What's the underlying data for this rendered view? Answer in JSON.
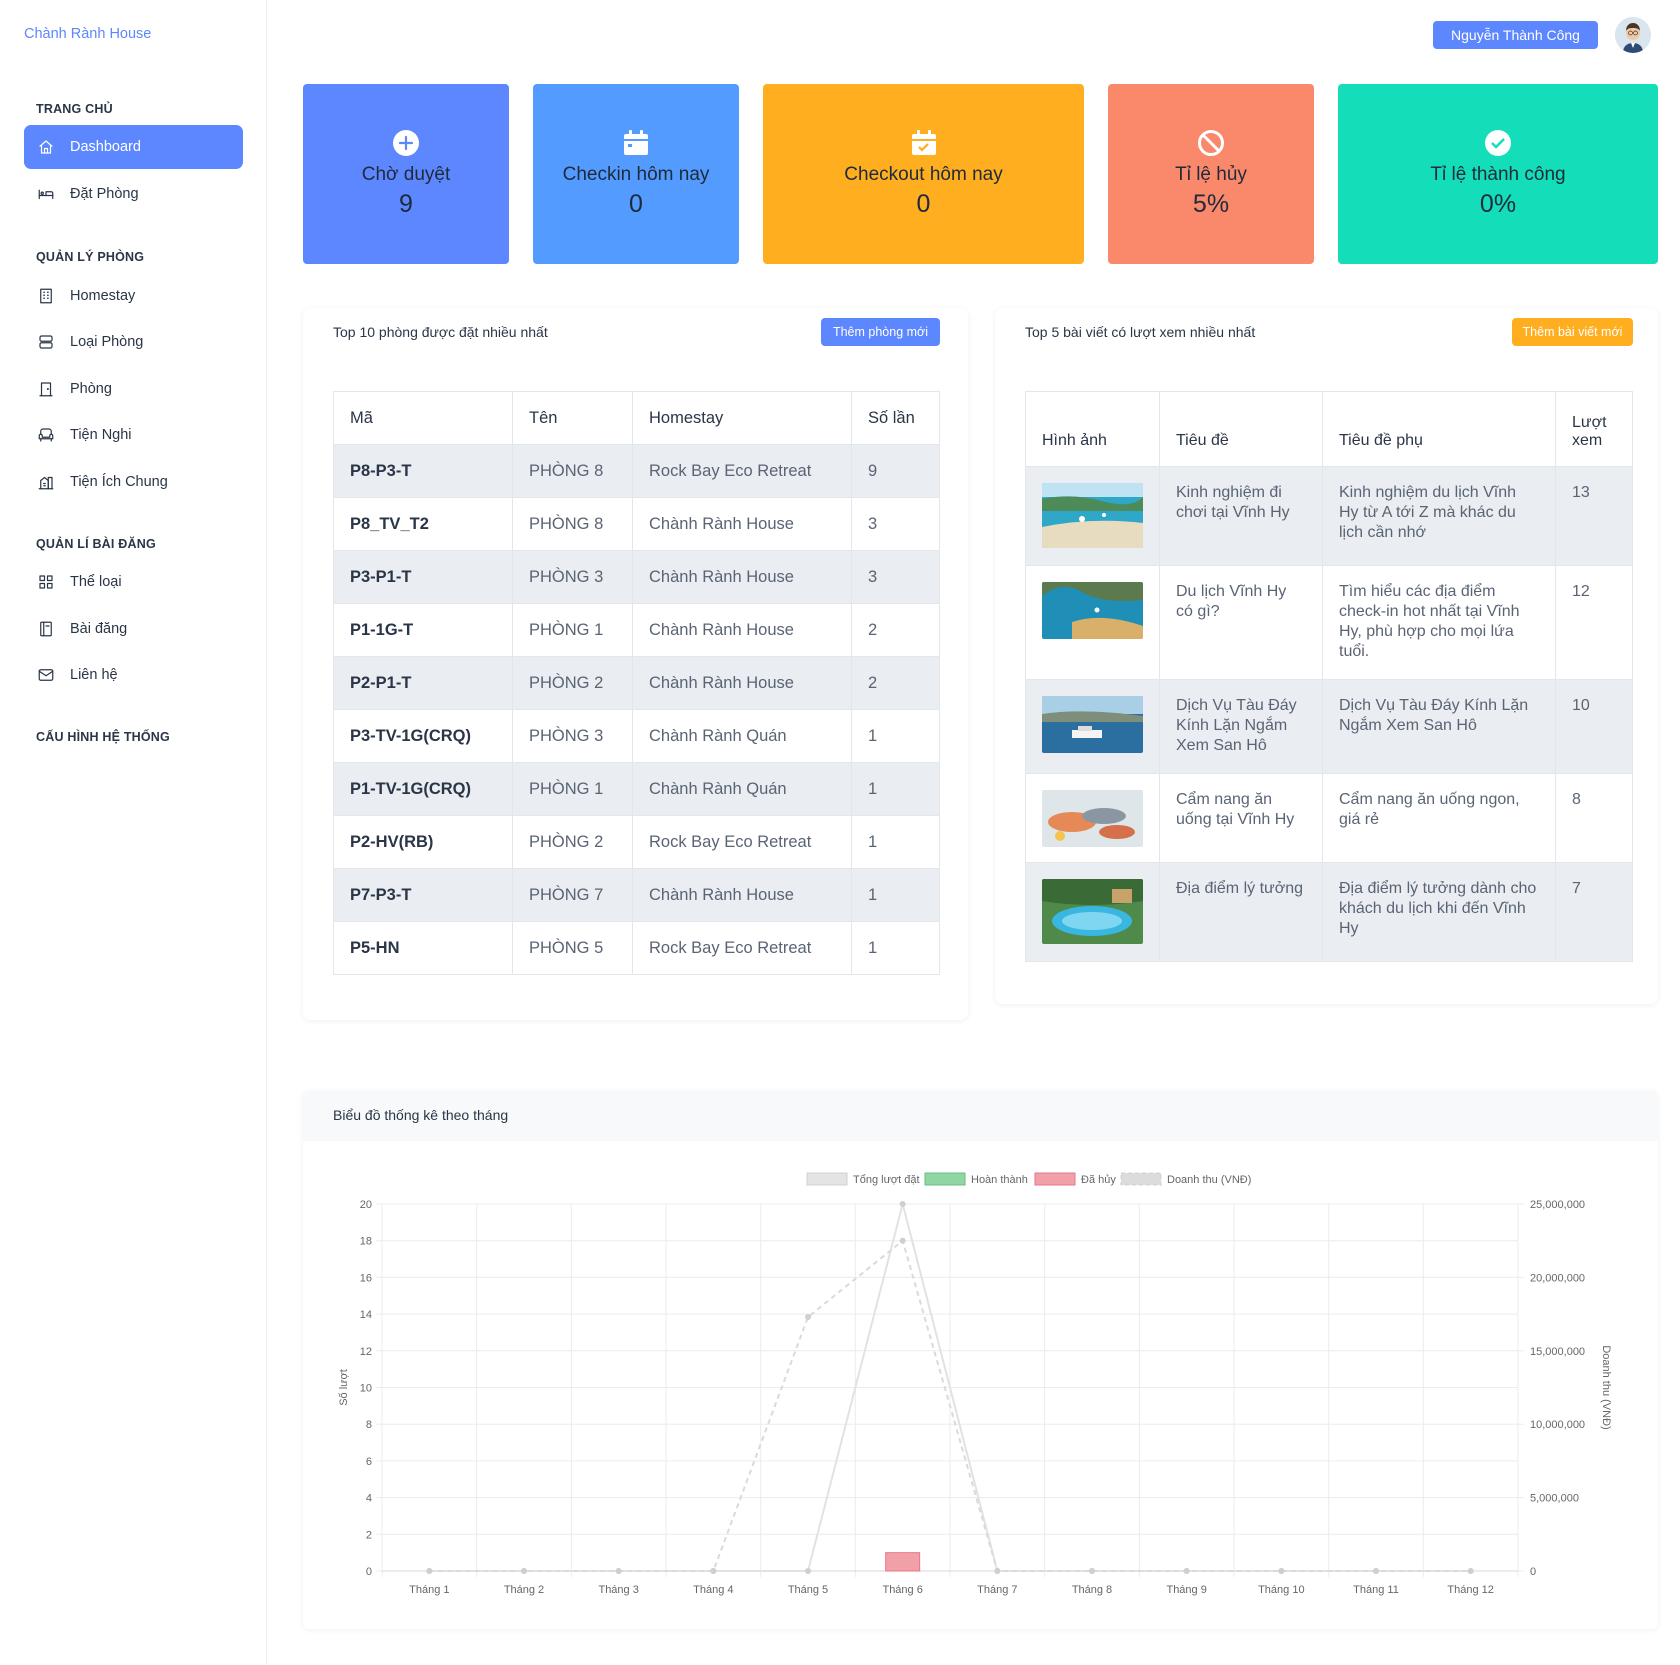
{
  "brand": "Chành Rành House",
  "sidebar": {
    "sections": [
      {
        "title": "TRANG CHỦ"
      },
      {
        "title": "QUẢN LÝ PHÒNG"
      },
      {
        "title": "QUẢN LÍ BÀI ĐĂNG"
      },
      {
        "title": "CẤU HÌNH HỆ THỐNG"
      }
    ],
    "items": [
      {
        "label": "Dashboard",
        "icon": "home-icon",
        "active": true
      },
      {
        "label": "Đặt Phòng",
        "icon": "bed-icon"
      },
      {
        "label": "Homestay",
        "icon": "building-icon"
      },
      {
        "label": "Loại Phòng",
        "icon": "server-icon"
      },
      {
        "label": "Phòng",
        "icon": "door-icon"
      },
      {
        "label": "Tiện Nghi",
        "icon": "armchair-icon"
      },
      {
        "label": "Tiện Ích Chung",
        "icon": "building-community-icon"
      },
      {
        "label": "Thể loại",
        "icon": "category-icon"
      },
      {
        "label": "Bài đăng",
        "icon": "book-icon"
      },
      {
        "label": "Liên hệ",
        "icon": "mail-icon"
      }
    ]
  },
  "header": {
    "user_name": "Nguyễn Thành Công"
  },
  "stats": [
    {
      "label": "Chờ duyệt",
      "value": "9",
      "color": "#5d87ff",
      "icon": "plus-circle-icon"
    },
    {
      "label": "Checkin hôm nay",
      "value": "0",
      "color": "#539bff",
      "icon": "calendar-icon"
    },
    {
      "label": "Checkout hôm nay",
      "value": "0",
      "color": "#ffae1f",
      "icon": "calendar-check-icon"
    },
    {
      "label": "Tỉ lệ hủy",
      "value": "5%",
      "color": "#fa896b",
      "icon": "ban-icon"
    },
    {
      "label": "Tỉ lệ thành công",
      "value": "0%",
      "color": "#13deb9",
      "icon": "check-circle-icon"
    }
  ],
  "rooms_card": {
    "title": "Top 10 phòng được đặt nhiều nhất",
    "button": "Thêm phòng mới",
    "columns": [
      "Mã",
      "Tên",
      "Homestay",
      "Số lần"
    ],
    "rows": [
      [
        "P8-P3-T",
        "PHÒNG 8",
        "Rock Bay Eco Retreat",
        "9"
      ],
      [
        "P8_TV_T2",
        "PHÒNG 8",
        "Chành Rành House",
        "3"
      ],
      [
        "P3-P1-T",
        "PHÒNG 3",
        "Chành Rành House",
        "3"
      ],
      [
        "P1-1G-T",
        "PHÒNG 1",
        "Chành Rành House",
        "2"
      ],
      [
        "P2-P1-T",
        "PHÒNG 2",
        "Chành Rành House",
        "2"
      ],
      [
        "P3-TV-1G(CRQ)",
        "PHÒNG 3",
        "Chành Rành Quán",
        "1"
      ],
      [
        "P1-TV-1G(CRQ)",
        "PHÒNG 1",
        "Chành Rành Quán",
        "1"
      ],
      [
        "P2-HV(RB)",
        "PHÒNG 2",
        "Rock Bay Eco Retreat",
        "1"
      ],
      [
        "P7-P3-T",
        "PHÒNG 7",
        "Chành Rành House",
        "1"
      ],
      [
        "P5-HN",
        "PHÒNG 5",
        "Rock Bay Eco Retreat",
        "1"
      ]
    ]
  },
  "posts_card": {
    "title": "Top 5 bài viết có lượt xem nhiều nhất",
    "button": "Thêm bài viết mới",
    "columns": [
      "Hình ảnh",
      "Tiêu đề",
      "Tiêu đề phụ",
      "Lượt xem"
    ],
    "rows": [
      {
        "title": "Kinh nghiệm đi chơi tại Vĩnh Hy",
        "subtitle": "Kinh nghiệm du lịch Vĩnh Hy từ A tới Z mà khác du lịch cần nhớ",
        "views": "13"
      },
      {
        "title": "Du lịch Vĩnh Hy có gì?",
        "subtitle": "Tìm hiểu các địa điểm check-in hot nhất tại Vĩnh Hy, phù hợp cho mọi lứa tuổi.",
        "views": "12"
      },
      {
        "title": "Dịch Vụ Tàu Đáy Kính Lặn Ngắm Xem San Hô",
        "subtitle": "Dịch Vụ Tàu Đáy Kính Lặn Ngắm Xem San Hô",
        "views": "10"
      },
      {
        "title": "Cẩm nang ăn uống tại Vĩnh Hy",
        "subtitle": "Cẩm nang ăn uống ngon, giá rẻ",
        "views": "8"
      },
      {
        "title": "Địa điểm lý tưởng",
        "subtitle": "Địa điểm lý tưởng dành cho khách du lịch khi đến Vĩnh Hy",
        "views": "7"
      }
    ]
  },
  "chart_card": {
    "title": "Biểu đồ thống kê theo tháng"
  },
  "chart_data": {
    "type": "bar",
    "categories": [
      "Tháng 1",
      "Tháng 2",
      "Tháng 3",
      "Tháng 4",
      "Tháng 5",
      "Tháng 6",
      "Tháng 7",
      "Tháng 8",
      "Tháng 9",
      "Tháng 10",
      "Tháng 11",
      "Tháng 12"
    ],
    "series": [
      {
        "name": "Tổng lượt đặt",
        "kind": "line",
        "axis": "left",
        "color": "#e4e4e4",
        "values": [
          0,
          0,
          0,
          0,
          0,
          20,
          0,
          0,
          0,
          0,
          0,
          0
        ]
      },
      {
        "name": "Hoàn thành",
        "kind": "bar",
        "axis": "left",
        "color": "#8fd6a3",
        "values": [
          0,
          0,
          0,
          0,
          0,
          0,
          0,
          0,
          0,
          0,
          0,
          0
        ]
      },
      {
        "name": "Đã hủy",
        "kind": "bar",
        "axis": "left",
        "color": "#f2a0a8",
        "values": [
          0,
          0,
          0,
          0,
          0,
          1,
          0,
          0,
          0,
          0,
          0,
          0
        ]
      },
      {
        "name": "Doanh thu (VNĐ)",
        "kind": "line-dashed",
        "axis": "right",
        "color": "#dcdcdc",
        "values": [
          0,
          0,
          0,
          0,
          17300000,
          22500000,
          0,
          0,
          0,
          0,
          0,
          0
        ]
      }
    ],
    "ylabel": "Số lượt",
    "y2label": "Doanh thu (VNĐ)",
    "ylim": [
      0,
      20
    ],
    "yticks": [
      "0",
      "2",
      "4",
      "6",
      "8",
      "10",
      "12",
      "14",
      "16",
      "18",
      "20"
    ],
    "y2lim": [
      0,
      25000000
    ],
    "y2ticks": [
      "0",
      "5,000,000",
      "10,000,000",
      "15,000,000",
      "20,000,000",
      "25,000,000"
    ],
    "grid": true,
    "legend": "top-center"
  }
}
